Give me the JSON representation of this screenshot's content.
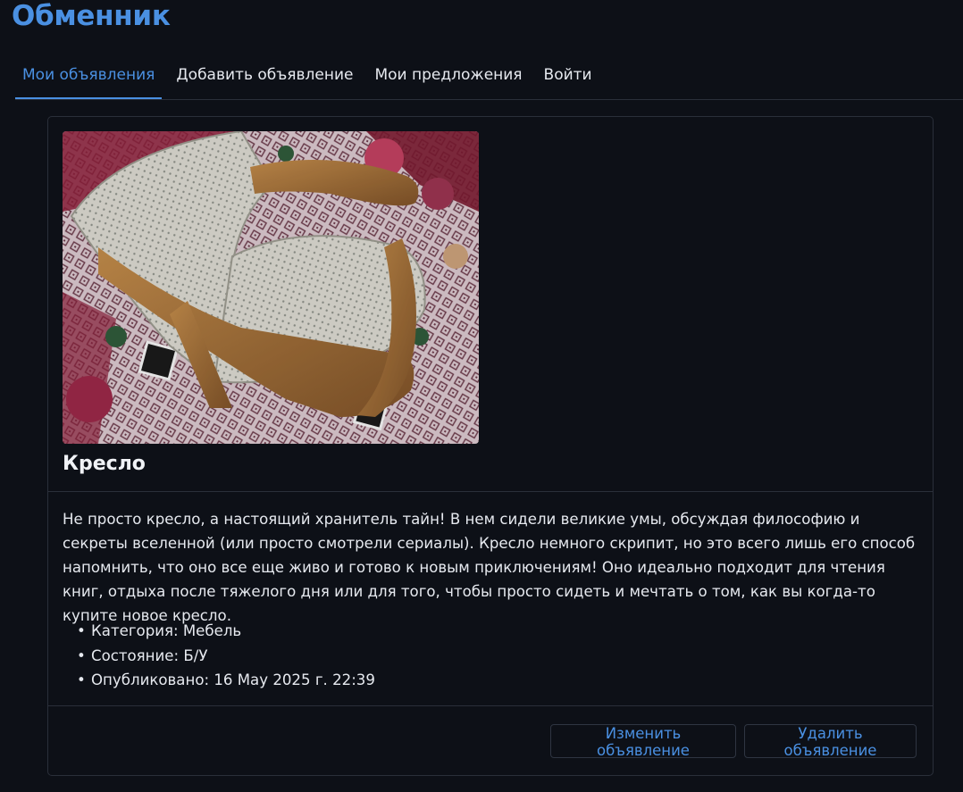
{
  "header": {
    "title": "Обменник"
  },
  "tabs": [
    {
      "label": "Мои объявления"
    },
    {
      "label": "Добавить объявление"
    },
    {
      "label": "Мои предложения"
    },
    {
      "label": "Войти"
    }
  ],
  "listing": {
    "title": "Кресло",
    "description": "Не просто кресло, а настоящий хранитель тайн! В нем сидели великие умы, обсуждая философию и секреты все­ленной (или просто смотрели сериалы). Кресло немного скрипит, но это всего лишь его способ напомнить, что оно все еще живо и готово к новым приключениям! Оно идеально подходит для чтения книг, отдыха после тяжелого дня или для того, чтобы просто сидеть и мечтать о том, как вы когда-то купите новое кресло.",
    "details": [
      "Категория: Мебель",
      "Состояние: Б/У",
      "Опубликовано: 16 May 2025 г. 22:39"
    ],
    "actions": {
      "edit_label": "Изменить объявление",
      "delete_label": "Удалить объявление"
    }
  },
  "colors": {
    "background": "#0d1017",
    "accent": "#4a90e2",
    "border": "#2a2f3a"
  }
}
